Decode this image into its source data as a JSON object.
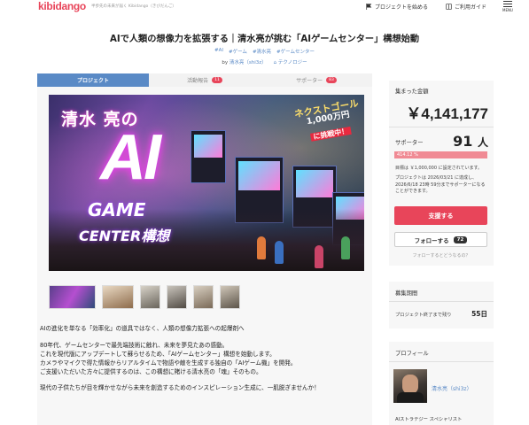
{
  "header": {
    "logo": "kibidango",
    "tagline": "半歩先の未来が届く Kibidango（きびだんご）",
    "start_project": "プロジェクトを始める",
    "guide": "ご利用ガイド",
    "menu": "MENU"
  },
  "project": {
    "title": "AIで人類の想像力を拡張する｜清水亮が挑む「AIゲームセンター」構想始動",
    "tags": [
      "#AI",
      "#ゲーム",
      "#清水亮",
      "#ゲームセンター"
    ],
    "by_prefix": "by",
    "author": "清水亮（shi3z）",
    "category": "テクノロジー"
  },
  "tabs": [
    {
      "label": "プロジェクト",
      "badge": null
    },
    {
      "label": "活動報告",
      "badge": "11"
    },
    {
      "label": "サポーター",
      "badge": "83"
    }
  ],
  "hero": {
    "name": "清水 亮の",
    "ai": "AI",
    "game": "GAME",
    "center": "CENTER",
    "kousou": "構想",
    "next1": "ネクストゴール",
    "next2": "1,000万円",
    "next3": "に挑戦中！"
  },
  "description": [
    "AIの進化を単なる「効率化」の道具ではなく、人類の想像力拡張への起爆剤へ",
    "80年代、ゲームセンターで最先端技術に触れ、未来を夢見たあの感動。",
    "これを現代版にアップデートして蘇らせるため、「AIゲームセンター」構想を始動します。",
    "カメラやマイクで得た情報からリアルタイムで物語や敵を生成する独自の「AIゲーム機」を開発。",
    "ご支援いただいた方々に提供するのは、この構想に賭ける清水亮の「魂」そのもの。",
    "現代の子供たちが目を輝かせながら未来を創造するためのインスピレーション生成に、一肌脱ぎませんか！"
  ],
  "funding": {
    "collected_label": "集まった金額",
    "amount": "￥4,141,177",
    "supporters_label": "サポーター",
    "supporters": "91",
    "supporters_unit": "人",
    "percent": "414.12 %",
    "percent_value": 1.0,
    "goal_note": "目標は ￥1,000,000 に設定されています。",
    "deadline_note": "プロジェクトは 2026/03/21 に達成し、2026/6/18 23時 59分までサポーターになることができます。",
    "support_button": "支援する",
    "follow_button": "フォローする",
    "follow_count": "72",
    "follow_link": "フォローするとどうなるの？"
  },
  "period": {
    "label": "募集期間",
    "remaining_label": "プロジェクト終了まで残り",
    "days": "55日"
  },
  "profile": {
    "label": "プロフィール",
    "name": "清水亮（shi3z）",
    "role": "AIストラテジー スペシャリスト"
  },
  "colors": {
    "brand": "#e8455a",
    "accent": "#5a8ac6"
  }
}
